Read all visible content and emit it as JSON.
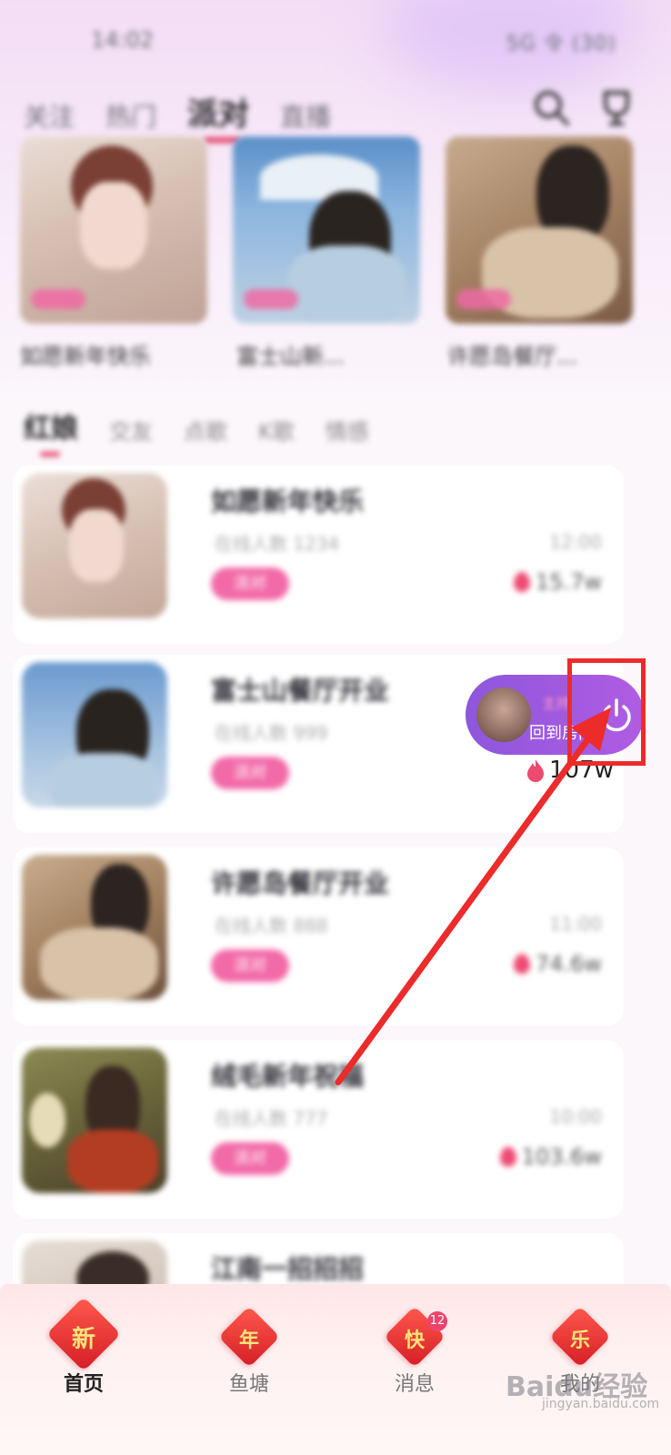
{
  "status_bar": {
    "time": "14:02",
    "right": "5G 令 (30)"
  },
  "top_tabs": [
    {
      "label": "关注"
    },
    {
      "label": "热门"
    },
    {
      "label": "派对"
    },
    {
      "label": "直播"
    }
  ],
  "hero_cards": [
    {
      "title": "如愿新年快乐"
    },
    {
      "title": "富士山新..."
    },
    {
      "title": "许愿岛餐厅..."
    }
  ],
  "section_tabs": [
    {
      "label": "红娘"
    },
    {
      "label": "交友"
    },
    {
      "label": "点歌"
    },
    {
      "label": "K歌"
    },
    {
      "label": "情感"
    }
  ],
  "rooms": [
    {
      "title": "如愿新年快乐",
      "sub": "在线人数 1234",
      "time": "12:00",
      "tag": "派对",
      "heat": "15.7w"
    },
    {
      "title": "富士山餐厅开业",
      "sub": "在线人数 999",
      "time": "",
      "tag": "派对",
      "heat": "107w"
    },
    {
      "title": "许愿岛餐厅开业",
      "sub": "在线人数 888",
      "time": "11:00",
      "tag": "派对",
      "heat": "74.6w"
    },
    {
      "title": "绒毛新年祝福",
      "sub": "在线人数 777",
      "time": "10:00",
      "tag": "派对",
      "heat": "103.6w"
    },
    {
      "title": "江南一招招招",
      "sub": "",
      "time": "",
      "tag": "",
      "heat": ""
    }
  ],
  "float_pill": {
    "label": "回到房间",
    "name": "主持"
  },
  "bottom_nav": [
    {
      "label": "首页",
      "icon_char": "新",
      "badge": ""
    },
    {
      "label": "鱼塘",
      "icon_char": "年",
      "badge": ""
    },
    {
      "label": "消息",
      "icon_char": "快",
      "badge": "12"
    },
    {
      "label": "我的",
      "icon_char": "乐",
      "badge": ""
    }
  ],
  "watermark": {
    "text": "Baidu经验",
    "sub": "jingyan.baidu.com"
  },
  "colors": {
    "accent": "#e23b64",
    "pill": "#9b59e0",
    "annotation": "#ec2b2b"
  }
}
